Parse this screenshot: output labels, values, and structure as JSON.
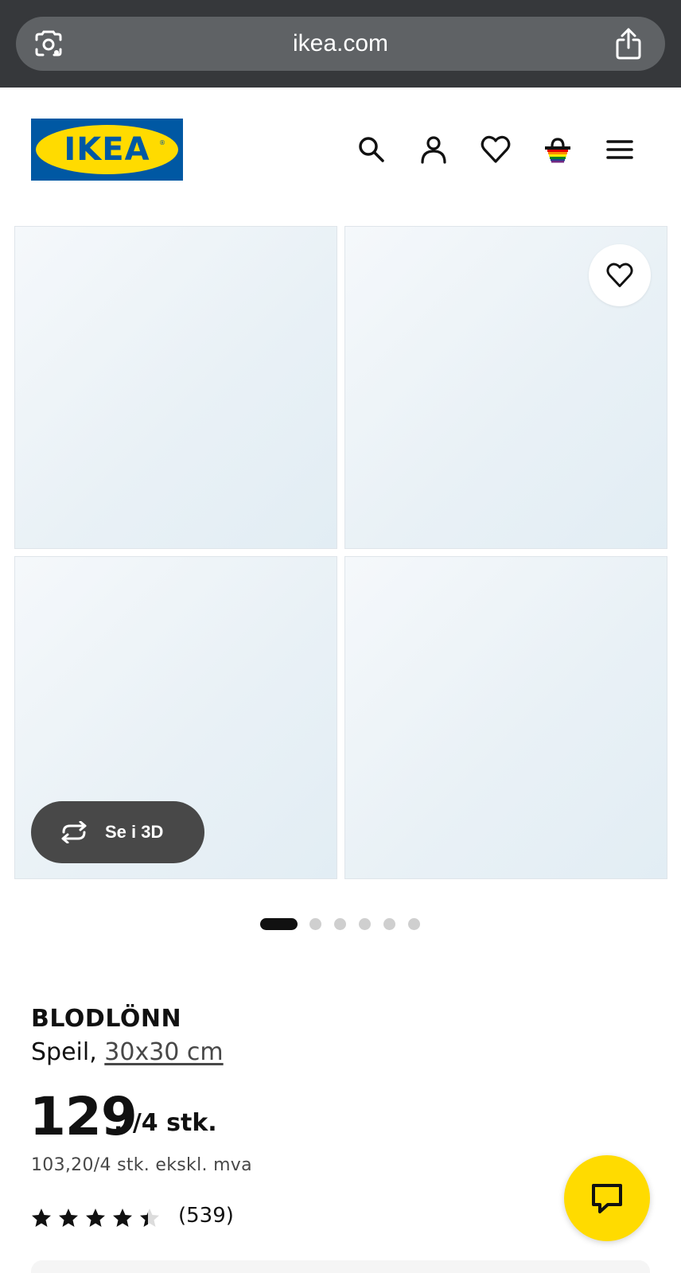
{
  "browser": {
    "url": "ikea.com",
    "left_icon": "google-lens-icon",
    "right_icon": "share-icon"
  },
  "header": {
    "logo_text": "IKEA",
    "logo_mark": "®",
    "icons": [
      "search-icon",
      "user-icon",
      "heart-icon",
      "shopping-bag-icon",
      "menu-icon"
    ]
  },
  "gallery": {
    "favorite_icon": "heart-icon",
    "view_3d_label": "Se i 3D",
    "view_3d_icon": "rotate-icon",
    "slide_count": 6,
    "active_slide": 1
  },
  "product": {
    "name": "BLODLÖNN",
    "type": "Speil,",
    "size": "30x30 cm",
    "price_main": "129",
    "price_suffix": ",-/4 stk.",
    "price_ex_vat": "103,20/4 stk. ekskl. mva",
    "rating": 4.5,
    "rating_max": 5,
    "review_count": "(539)"
  },
  "chat": {
    "icon": "chat-icon"
  },
  "colors": {
    "ikea_blue": "#0058a3",
    "ikea_yellow": "#ffdb00",
    "dark_pill": "#484848",
    "browser_bar": "#36383b"
  }
}
